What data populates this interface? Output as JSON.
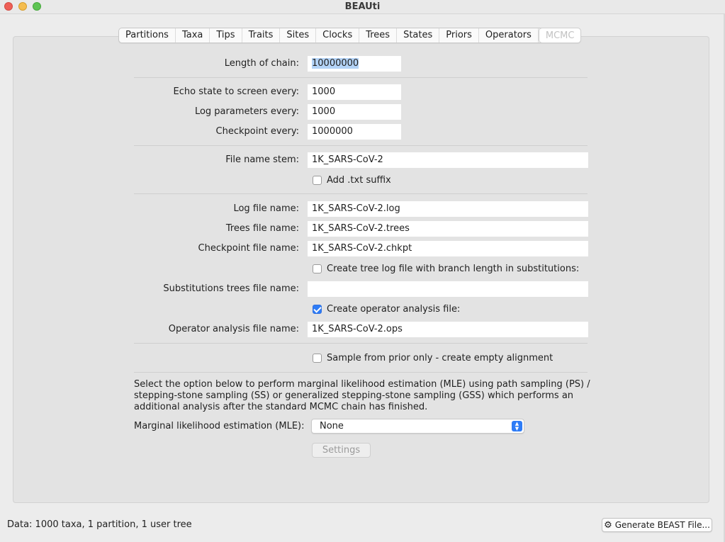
{
  "window": {
    "title": "BEAUti"
  },
  "tabs": [
    "Partitions",
    "Taxa",
    "Tips",
    "Traits",
    "Sites",
    "Clocks",
    "Trees",
    "States",
    "Priors",
    "Operators",
    "MCMC"
  ],
  "active_tab": "MCMC",
  "form": {
    "chain_length_label": "Length of chain:",
    "chain_length_value": "10000000",
    "echo_label": "Echo state to screen every:",
    "echo_value": "1000",
    "log_params_label": "Log parameters every:",
    "log_params_value": "1000",
    "checkpoint_label": "Checkpoint every:",
    "checkpoint_value": "1000000",
    "file_stem_label": "File name stem:",
    "file_stem_value": "1K_SARS-CoV-2",
    "add_txt_label": "Add .txt suffix",
    "add_txt_checked": false,
    "log_file_label": "Log file name:",
    "log_file_value": "1K_SARS-CoV-2.log",
    "trees_file_label": "Trees file name:",
    "trees_file_value": "1K_SARS-CoV-2.trees",
    "checkpoint_file_label": "Checkpoint file name:",
    "checkpoint_file_value": "1K_SARS-CoV-2.chkpt",
    "tree_log_subst_label": "Create tree log file with branch length in substitutions:",
    "tree_log_subst_checked": false,
    "subst_trees_label": "Substitutions trees file name:",
    "subst_trees_value": "",
    "operator_analysis_label": "Create operator analysis file:",
    "operator_analysis_checked": true,
    "operator_file_label": "Operator analysis file name:",
    "operator_file_value": "1K_SARS-CoV-2.ops",
    "sample_prior_label": "Sample from prior only - create empty alignment",
    "sample_prior_checked": false,
    "mle_description": "Select the option below to perform marginal likelihood estimation (MLE) using path sampling (PS) / stepping-stone sampling (SS) or generalized stepping-stone sampling (GSS) which performs an additional analysis after the standard MCMC chain has finished.",
    "mle_label": "Marginal likelihood estimation (MLE):",
    "mle_value": "None",
    "settings_label": "Settings"
  },
  "status": {
    "data_summary": "Data: 1000 taxa, 1 partition, 1 user tree",
    "generate_label": "Generate BEAST File..."
  },
  "colors": {
    "accent": "#2e7cf6",
    "selection": "#b3d3f7"
  }
}
